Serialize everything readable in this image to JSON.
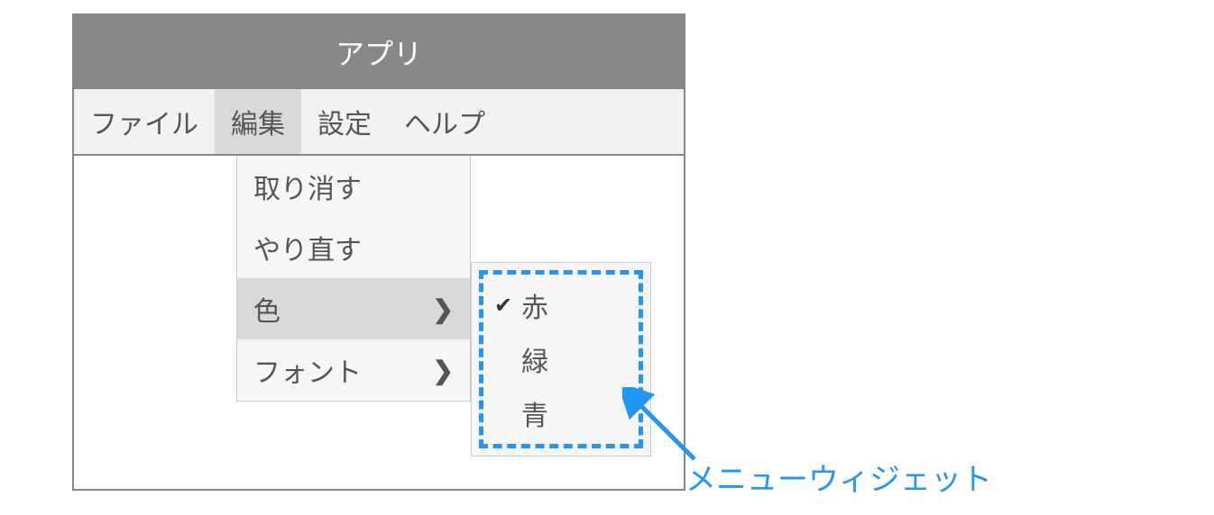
{
  "window": {
    "title": "アプリ"
  },
  "menubar": {
    "items": [
      {
        "label": "ファイル"
      },
      {
        "label": "編集"
      },
      {
        "label": "設定"
      },
      {
        "label": "ヘルプ"
      }
    ]
  },
  "dropdown": {
    "items": [
      {
        "label": "取り消す",
        "has_submenu": false
      },
      {
        "label": "やり直す",
        "has_submenu": false
      },
      {
        "label": "色",
        "has_submenu": true,
        "hover": true
      },
      {
        "label": "フォント",
        "has_submenu": true
      }
    ]
  },
  "submenu": {
    "items": [
      {
        "label": "赤",
        "checked": true
      },
      {
        "label": "緑",
        "checked": false
      },
      {
        "label": "青",
        "checked": false
      }
    ]
  },
  "callout": {
    "label": "メニューウィジェット"
  },
  "colors": {
    "highlight": "#2196f3",
    "title_bg": "#888888",
    "menu_bg": "#f2f2f2",
    "hover_bg": "#d9d9d9"
  }
}
